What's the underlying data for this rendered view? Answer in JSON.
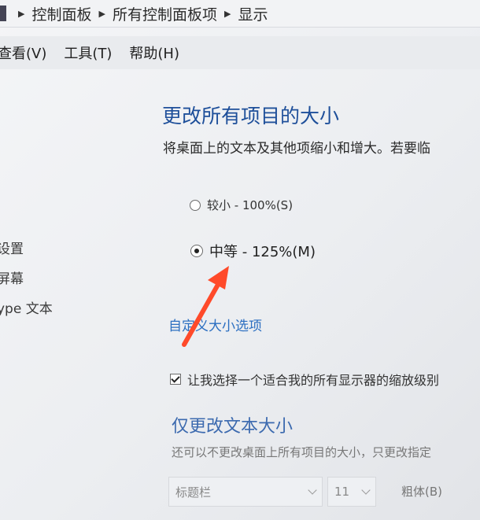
{
  "address_bar": {
    "crumbs": [
      "控制面板",
      "所有控制面板项",
      "显示"
    ]
  },
  "menu": {
    "items": [
      "查看(V)",
      "工具(T)",
      "帮助(H)"
    ]
  },
  "sidebar": {
    "links": [
      "设置",
      "屏幕",
      "ype 文本"
    ]
  },
  "main": {
    "title": "更改所有项目的大小",
    "description": "将桌面上的文本及其他项缩小和增大。若要临",
    "options": [
      {
        "label": "较小 - 100%(S)",
        "checked": false
      },
      {
        "label": "中等 - 125%(M)",
        "checked": true
      }
    ],
    "custom_link": "自定义大小选项",
    "checkbox_label": "让我选择一个适合我的所有显示器的缩放级别",
    "checkbox_checked": true,
    "text_size_title": "仅更改文本大小",
    "text_size_desc": "还可以不更改桌面上所有项目的大小，只更改指定",
    "element_select": "标题栏",
    "size_select": "11",
    "bold_label": "粗体(B)"
  },
  "colors": {
    "title": "#1e4f9a",
    "link": "#2c6fc1",
    "annotation_arrow": "#ff4a2a"
  },
  "icons": {
    "breadcrumb_separator": "triangle-right-icon",
    "annotation": "red-arrow-icon"
  }
}
